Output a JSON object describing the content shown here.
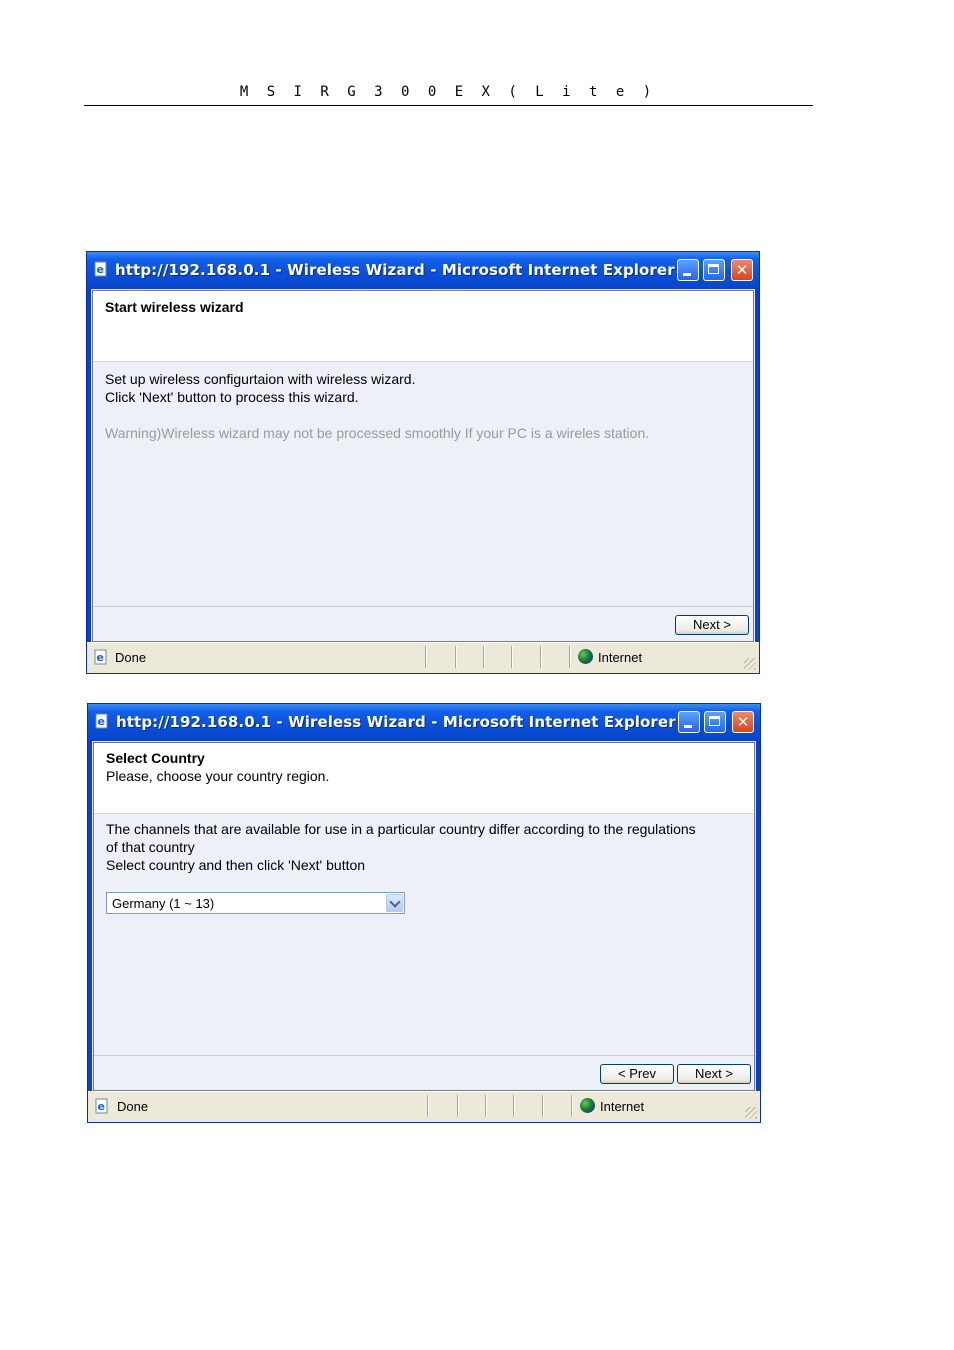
{
  "document": {
    "header": "M S I  R G 3 0 0 E X ( L i t e )"
  },
  "windows": [
    {
      "title": "http://192.168.0.1 - Wireless Wizard - Microsoft Internet Explorer",
      "controls": {
        "minimize": "minimize",
        "maximize": "maximize",
        "close": "✕"
      },
      "heading": "Start wireless wizard",
      "body_lines": [
        "Set up wireless configurtaion with wireless wizard.",
        "Click 'Next' button to process this wizard."
      ],
      "warning": "Warning)Wireless wizard may not be processed smoothly If your PC is a wireles station.",
      "buttons": {
        "next": "Next >"
      },
      "status": {
        "left": "Done",
        "zone": "Internet"
      }
    },
    {
      "title": "http://192.168.0.1 - Wireless Wizard - Microsoft Internet Explorer",
      "controls": {
        "minimize": "minimize",
        "maximize": "maximize",
        "close": "✕"
      },
      "heading": "Select Country",
      "subheading": "Please, choose your country region.",
      "body_lines": [
        "The channels that are available for use in a particular country differ according to the regulations",
        "of that country",
        "Select country and then click 'Next' button"
      ],
      "country_select": {
        "selected": "Germany (1 ~ 13)"
      },
      "buttons": {
        "prev": "< Prev",
        "next": "Next >"
      },
      "status": {
        "left": "Done",
        "zone": "Internet"
      }
    }
  ],
  "colors": {
    "titlebar": "#0a4fdc",
    "frame": "#0a3fd6",
    "page_bg": "#eef0f8",
    "warning_text": "#9a9a9a"
  }
}
